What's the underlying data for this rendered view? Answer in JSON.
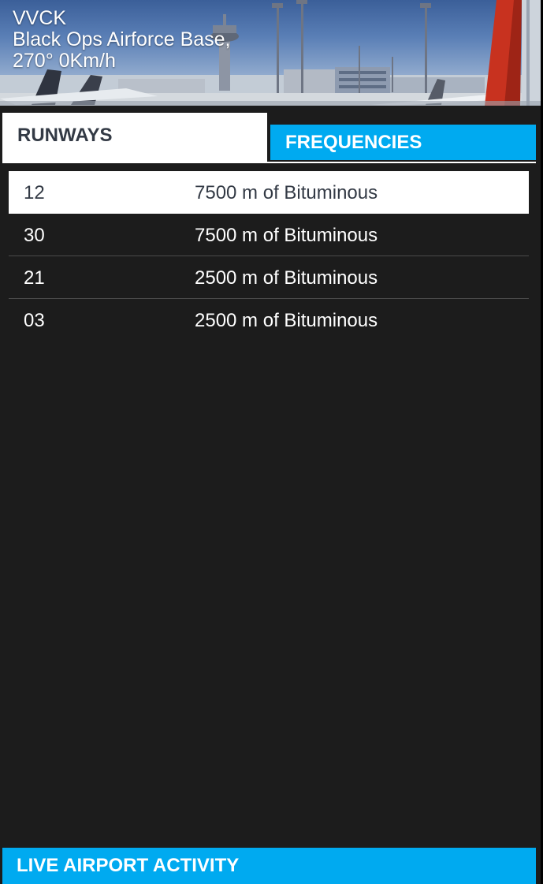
{
  "header": {
    "code": "VVCK",
    "name": "Black Ops Airforce Base,",
    "wind": "270° 0Km/h"
  },
  "tabs": [
    {
      "label": "RUNWAYS",
      "active": true
    },
    {
      "label": "FREQUENCIES",
      "active": false
    }
  ],
  "runways": [
    {
      "id": "12",
      "description": "7500 m of Bituminous",
      "selected": true
    },
    {
      "id": "30",
      "description": "7500 m of Bituminous",
      "selected": false
    },
    {
      "id": "21",
      "description": "2500 m of Bituminous",
      "selected": false
    },
    {
      "id": "03",
      "description": "2500 m of Bituminous",
      "selected": false
    }
  ],
  "footer": {
    "label": "LIVE AIRPORT ACTIVITY"
  },
  "colors": {
    "accent": "#00aaf0",
    "panel_background": "#1c1c1c",
    "selected_row": "#ffffff",
    "selected_text": "#333a45"
  }
}
